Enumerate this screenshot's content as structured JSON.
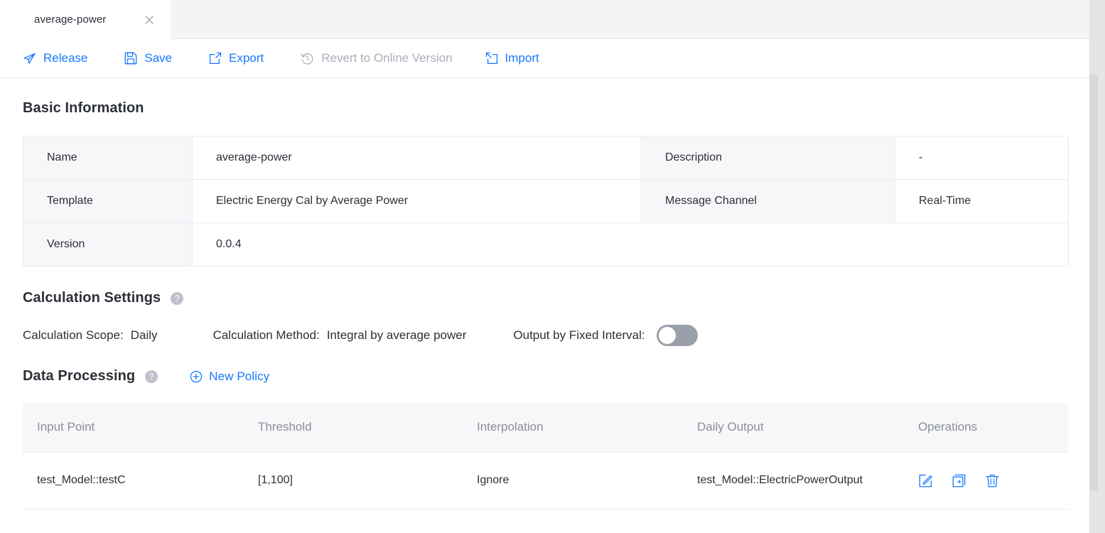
{
  "tab": {
    "label": "average-power",
    "close_icon": "close-icon"
  },
  "toolbar": {
    "release_label": "Release",
    "save_label": "Save",
    "export_label": "Export",
    "revert_label": "Revert to Online Version",
    "import_label": "Import",
    "accent_color": "#1677ff",
    "disabled_color": "#a9aeb8"
  },
  "basic_information": {
    "title": "Basic Information",
    "rows": [
      {
        "label": "Name",
        "value": "average-power",
        "label2": "Description",
        "value2": "-"
      },
      {
        "label": "Template",
        "value": "Electric Energy Cal by Average Power",
        "label2": "Message Channel",
        "value2": "Real-Time"
      },
      {
        "label": "Version",
        "value": "0.0.4"
      }
    ]
  },
  "calculation_settings": {
    "title": "Calculation Settings",
    "help_icon": "?",
    "scope_label": "Calculation Scope:",
    "scope_value": "Daily",
    "method_label": "Calculation Method:",
    "method_value": "Integral by average power",
    "fixed_interval_label": "Output by Fixed Interval:",
    "fixed_interval_on": false
  },
  "data_processing": {
    "title": "Data Processing",
    "help_icon": "?",
    "new_policy_label": "New Policy",
    "columns": [
      "Input Point",
      "Threshold",
      "Interpolation",
      "Daily Output",
      "Operations"
    ],
    "rows": [
      {
        "input_point": "test_Model::testC",
        "threshold": "[1,100]",
        "interpolation": "Ignore",
        "daily_output": "test_Model::ElectricPowerOutput",
        "operations": [
          "edit-icon",
          "copy-icon",
          "delete-icon"
        ]
      }
    ]
  }
}
